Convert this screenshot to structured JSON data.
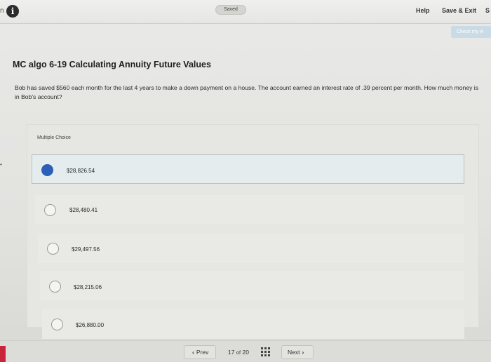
{
  "header": {
    "left_fragment": "n",
    "saved_status": "Saved",
    "help_label": "Help",
    "save_exit_label": "Save & Exit",
    "submit_fragment": "S",
    "check_label": "Check my w"
  },
  "question": {
    "title": "MC algo 6-19 Calculating Annuity Future Values",
    "text": "Bob has saved $560 each month for the last 4 years to make a down payment on a house. The account earned an interest rate of .39 percent per month. How much money is in Bob's account?",
    "section_label": "Multiple Choice",
    "options": [
      {
        "label": "$28,826.54",
        "selected": true
      },
      {
        "label": "$28,480.41",
        "selected": false
      },
      {
        "label": "$29,497.56",
        "selected": false
      },
      {
        "label": "$28,215.06",
        "selected": false
      },
      {
        "label": "$26,880.00",
        "selected": false
      }
    ]
  },
  "footer": {
    "prev_label": "Prev",
    "current_page": "17",
    "of_label": "of",
    "total_pages": "20",
    "next_label": "Next"
  },
  "colors": {
    "accent": "#2b5fb8",
    "alert_tab": "#c8253b",
    "check_button": "#c9dbe6"
  }
}
